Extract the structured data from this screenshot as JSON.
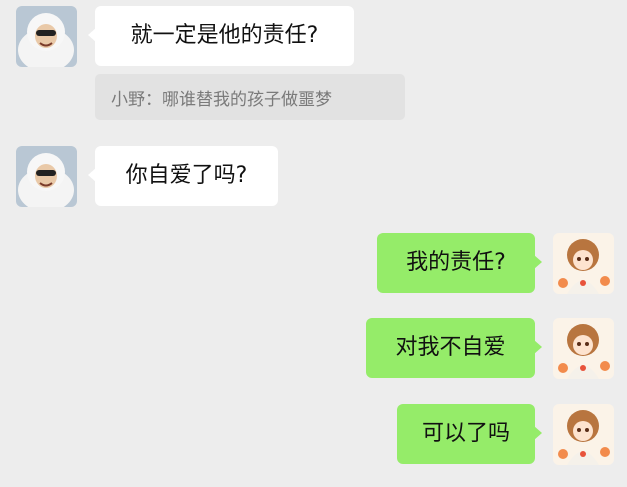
{
  "chat": {
    "messages": [
      {
        "side": "left",
        "text": "就一定是他的责任?"
      },
      {
        "side": "left",
        "type": "quote",
        "text": "小野：哪谁替我的孩子做噩梦"
      },
      {
        "side": "left",
        "text": "你自爱了吗?"
      },
      {
        "side": "right",
        "text": "我的责任?"
      },
      {
        "side": "right",
        "text": "对我不自爱"
      },
      {
        "side": "right",
        "text": "可以了吗"
      }
    ]
  },
  "colors": {
    "background": "#ededed",
    "incoming_bubble": "#ffffff",
    "outgoing_bubble": "#95ec69",
    "quote_background": "#e2e2e2"
  },
  "icons": {
    "left_avatar": "girl-in-white-hoodie-avatar",
    "right_avatar": "anime-girl-avatar"
  }
}
